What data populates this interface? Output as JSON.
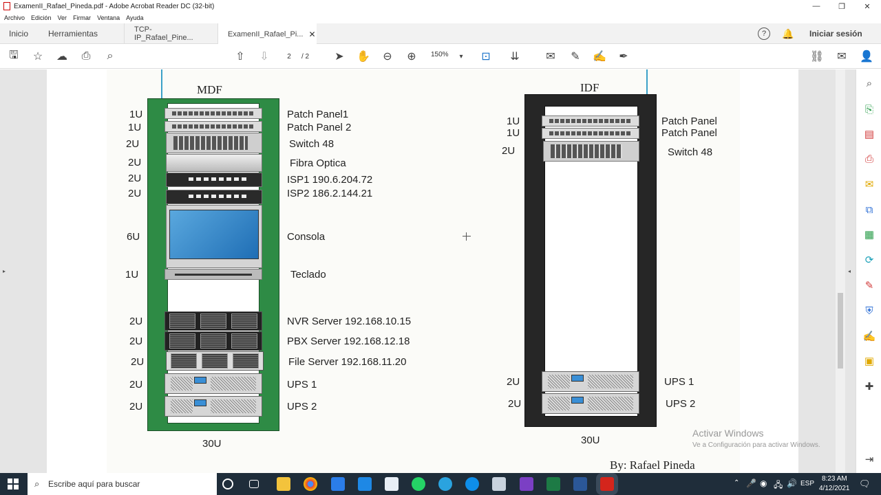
{
  "window": {
    "title": "ExamenII_Rafael_Pineda.pdf - Adobe Acrobat Reader DC (32-bit)",
    "minimize": "—",
    "maximize": "❐",
    "close": "✕"
  },
  "menu": [
    "Archivo",
    "Edición",
    "Ver",
    "Firmar",
    "Ventana",
    "Ayuda"
  ],
  "tabs": {
    "home": "Inicio",
    "tools": "Herramientas",
    "docs": [
      {
        "label": "TCP-IP_Rafael_Pine..."
      },
      {
        "label": "ExamenII_Rafael_Pi...",
        "close": "✕"
      }
    ],
    "help": "?",
    "signin": "Iniciar sesión"
  },
  "toolbar": {
    "page_current": "2",
    "page_total": "/ 2",
    "zoom": "150%"
  },
  "mdf": {
    "title": "MDF",
    "total": "30U",
    "units": [
      "1U",
      "1U",
      "2U",
      "2U",
      "2U",
      "2U",
      "6U",
      "1U",
      "2U",
      "2U",
      "2U",
      "2U",
      "2U"
    ],
    "labels": [
      "Patch Panel1",
      "Patch Panel 2",
      "Switch 48",
      "Fibra Optica",
      "ISP1 190.6.204.72",
      "ISP2 186.2.144.21",
      "Consola",
      "Teclado",
      "NVR Server  192.168.10.15",
      "PBX Server 192.168.12.18",
      "File Server 192.168.11.20",
      "UPS 1",
      "UPS 2"
    ]
  },
  "idf": {
    "title": "IDF",
    "total": "30U",
    "units": [
      "1U",
      "1U",
      "2U",
      "2U",
      "2U"
    ],
    "labels": [
      "Patch Panel",
      "Patch Panel",
      "Switch 48",
      "UPS 1",
      "UPS 2"
    ]
  },
  "author": "By: Rafael Pineda",
  "watermark": {
    "title": "Activar Windows",
    "sub": "Ve a Configuración para activar Windows."
  },
  "taskbar": {
    "search_placeholder": "Escribe aquí para buscar",
    "lang": "ESP",
    "time": "8:23 AM",
    "date": "4/12/2021"
  },
  "colors": {
    "mdf_rack": "#2e8b45",
    "idf_rack": "#262626",
    "accent": "#1a73c9"
  }
}
